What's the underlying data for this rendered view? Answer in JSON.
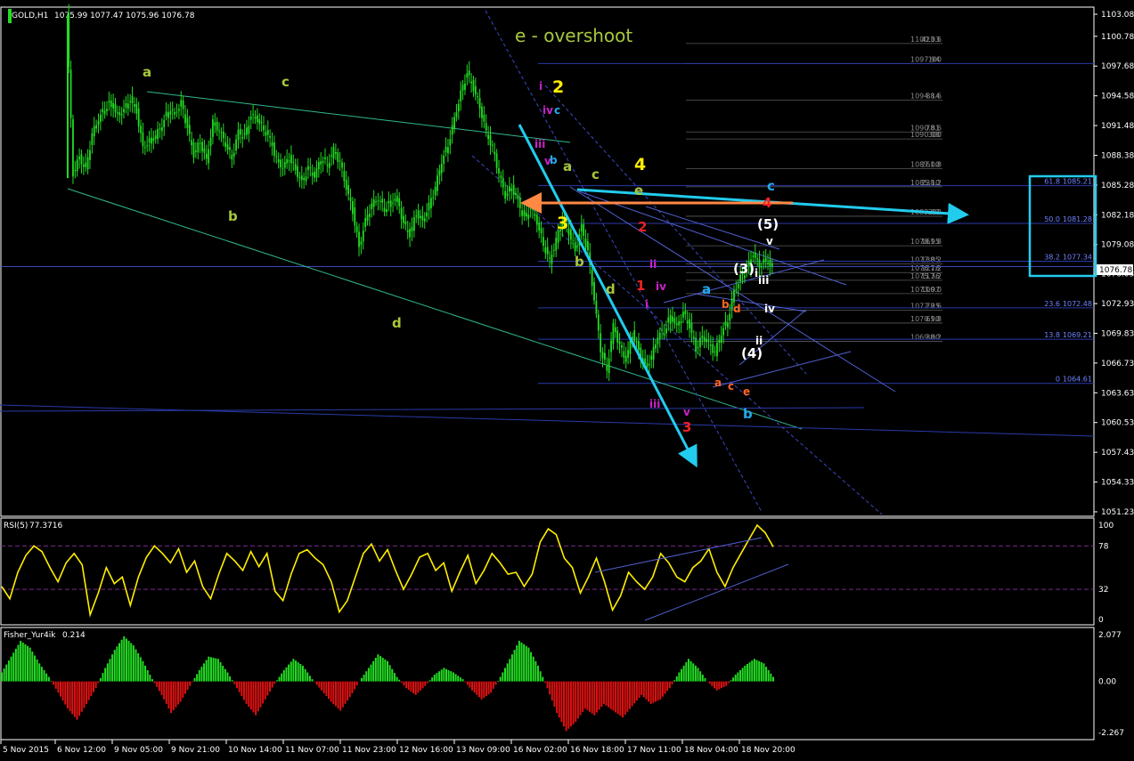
{
  "header": {
    "symbol_label": "GOLD,H1",
    "ohlc": "1075.99 1077.47 1075.96 1076.78",
    "title_annotation": "e - overshoot"
  },
  "colors": {
    "background": "#000000",
    "candle": "#22dd22",
    "price_line": "#2a3aa8",
    "rsi_line": "#ffee00",
    "fisher_up": "#22dd22",
    "fisher_down": "#dd1111",
    "cyan": "#22ccee",
    "orange": "#ff8844",
    "wave_green": "#a8c83c",
    "wave_yellow": "#ffee00",
    "wave_magenta": "#cc22cc",
    "wave_red": "#ee2222",
    "wave_blue": "#22aaee",
    "wave_orange": "#ff6622"
  },
  "chart_data": [
    {
      "type": "candlestick",
      "instrument": "GOLD",
      "timeframe": "H1",
      "ylim": [
        1051.23,
        1103.08
      ],
      "price_ticks": [
        "1103.08",
        "1100.78",
        "1097.68",
        "1094.58",
        "1091.48",
        "1088.38",
        "1085.28",
        "1082.18",
        "1079.08",
        "1076.03",
        "1072.93",
        "1069.83",
        "1066.73",
        "1063.63",
        "1060.53",
        "1057.43",
        "1054.33",
        "1051.23"
      ],
      "current_price": "1076.78",
      "x_ticks": [
        "5 Nov 2015",
        "6 Nov 12:00",
        "9 Nov 05:00",
        "9 Nov 21:00",
        "10 Nov 14:00",
        "11 Nov 07:00",
        "11 Nov 23:00",
        "12 Nov 16:00",
        "13 Nov 09:00",
        "16 Nov 02:00",
        "16 Nov 18:00",
        "17 Nov 11:00",
        "18 Nov 04:00",
        "18 Nov 20:00"
      ],
      "price_path": [
        1103.0,
        1086.5,
        1088.2,
        1086.8,
        1090.5,
        1092.2,
        1093.3,
        1094.0,
        1092.5,
        1093.1,
        1094.2,
        1093.0,
        1089.2,
        1089.8,
        1090.4,
        1091.6,
        1093.1,
        1092.7,
        1093.8,
        1091.2,
        1088.5,
        1089.8,
        1087.8,
        1091.8,
        1091.0,
        1089.6,
        1088.1,
        1090.8,
        1090.2,
        1092.5,
        1092.2,
        1091.1,
        1090.1,
        1087.9,
        1087.1,
        1088.2,
        1086.9,
        1085.5,
        1087.0,
        1086.2,
        1088.1,
        1087.4,
        1088.9,
        1087.6,
        1085.0,
        1082.6,
        1078.8,
        1081.5,
        1083.2,
        1083.9,
        1082.8,
        1083.6,
        1083.8,
        1081.2,
        1080.1,
        1082.4,
        1081.5,
        1083.1,
        1085.0,
        1087.8,
        1089.5,
        1092.2,
        1094.8,
        1096.9,
        1095.4,
        1093.5,
        1090.8,
        1089.1,
        1086.5,
        1084.2,
        1085.1,
        1083.6,
        1081.7,
        1082.9,
        1081.5,
        1079.1,
        1077.4,
        1079.5,
        1081.6,
        1080.4,
        1078.5,
        1080.9,
        1078.2,
        1073.4,
        1068.2,
        1066.0,
        1070.6,
        1068.5,
        1067.0,
        1069.8,
        1068.1,
        1066.3,
        1067.3,
        1069.6,
        1070.1,
        1071.7,
        1070.5,
        1071.9,
        1070.6,
        1068.2,
        1069.5,
        1068.8,
        1067.8,
        1069.9,
        1071.2,
        1074.2,
        1075.6,
        1076.5,
        1078.1,
        1076.9,
        1077.5,
        1076.8
      ],
      "fib_levels_upper": [
        {
          "pct": "423.6",
          "price": "1100.03"
        },
        {
          "pct": "100",
          "price": "1097.94"
        },
        {
          "pct": "88.6",
          "price": "1094.14"
        },
        {
          "pct": "78.6",
          "price": "1090.81"
        },
        {
          "pct": "300",
          "price": "1090.08"
        },
        {
          "pct": "261.8",
          "price": "1087.00"
        },
        {
          "pct": "238.2",
          "price": "1085.10"
        },
        {
          "pct": "200",
          "price": "1082.03"
        },
        {
          "pct": "161.8",
          "price": "1078.95"
        },
        {
          "pct": "138.2",
          "price": "1077.05"
        },
        {
          "pct": "127.2",
          "price": "1076.16"
        },
        {
          "pct": "117.2",
          "price": "1075.36"
        },
        {
          "pct": "100.0",
          "price": "1073.97"
        },
        {
          "pct": "78.6",
          "price": "1072.25"
        },
        {
          "pct": "61.8",
          "price": "1070.90"
        },
        {
          "pct": "38.2",
          "price": "1069.00"
        }
      ],
      "fib_levels_right": [
        {
          "pct": "61.8",
          "price": "1085.21"
        },
        {
          "pct": "50.0",
          "price": "1081.28"
        },
        {
          "pct": "38.2",
          "price": "1077.34"
        },
        {
          "pct": "23.6",
          "price": "1072.48"
        },
        {
          "pct": "13.8",
          "price": "1069.21"
        },
        {
          "pct": "0",
          "price": "1064.61"
        }
      ],
      "wave_labels": [
        "a",
        "b",
        "c",
        "d",
        "e",
        "1",
        "2",
        "3",
        "4",
        "5",
        "(3)",
        "(4)",
        "(5)",
        "i",
        "ii",
        "iii",
        "iv",
        "v"
      ]
    },
    {
      "type": "line",
      "indicator": "RSI(5)",
      "value_label": "77.3716",
      "ylim": [
        0,
        100
      ],
      "ticks": [
        "100",
        "78",
        "32",
        "0"
      ],
      "levels": [
        78,
        32
      ],
      "values": [
        35,
        22,
        50,
        68,
        78,
        72,
        55,
        40,
        60,
        70,
        58,
        5,
        28,
        55,
        38,
        45,
        15,
        45,
        66,
        78,
        70,
        60,
        75,
        50,
        62,
        35,
        22,
        48,
        70,
        62,
        52,
        72,
        56,
        70,
        30,
        20,
        48,
        70,
        74,
        65,
        58,
        40,
        8,
        20,
        45,
        70,
        80,
        62,
        74,
        52,
        32,
        48,
        66,
        70,
        52,
        60,
        30,
        50,
        68,
        38,
        52,
        70,
        60,
        48,
        50,
        35,
        48,
        82,
        96,
        90,
        65,
        55,
        28,
        45,
        65,
        40,
        10,
        25,
        50,
        40,
        32,
        45,
        70,
        60,
        45,
        40,
        55,
        62,
        75,
        50,
        35,
        55,
        70,
        85,
        100,
        92,
        77
      ]
    },
    {
      "type": "bar",
      "indicator": "Fisher_Yur4ik",
      "value_label": "0.214",
      "ylim": [
        -2.267,
        2.077
      ],
      "ticks": [
        "2.077",
        "0.00",
        "-2.267"
      ],
      "values": [
        0.4,
        1.1,
        1.8,
        1.5,
        0.8,
        0.2,
        -0.5,
        -1.2,
        -1.7,
        -1.0,
        -0.3,
        0.6,
        1.4,
        2.0,
        1.6,
        0.9,
        0.1,
        -0.6,
        -1.4,
        -0.9,
        -0.2,
        0.5,
        1.1,
        1.0,
        0.4,
        -0.3,
        -1.0,
        -1.5,
        -0.8,
        -0.1,
        0.5,
        1.0,
        0.7,
        0.1,
        -0.4,
        -0.9,
        -1.3,
        -0.7,
        0.0,
        0.6,
        1.2,
        0.9,
        0.2,
        -0.3,
        -0.6,
        -0.2,
        0.3,
        0.6,
        0.4,
        0.1,
        -0.4,
        -0.8,
        -0.5,
        0.2,
        1.0,
        1.8,
        1.5,
        0.7,
        -0.3,
        -1.4,
        -2.2,
        -1.8,
        -1.2,
        -1.5,
        -1.0,
        -1.3,
        -1.6,
        -1.1,
        -0.6,
        -1.0,
        -0.8,
        -0.3,
        0.4,
        1.0,
        0.6,
        0.0,
        -0.4,
        -0.2,
        0.3,
        0.7,
        1.0,
        0.8,
        0.2
      ]
    }
  ],
  "annotations": [
    {
      "text": "a",
      "color": "#a8c83c"
    },
    {
      "text": "b",
      "color": "#a8c83c"
    },
    {
      "text": "c",
      "color": "#a8c83c"
    },
    {
      "text": "d",
      "color": "#a8c83c"
    },
    {
      "text": "2",
      "color": "#ffee00"
    },
    {
      "text": "4",
      "color": "#ffee00"
    },
    {
      "text": "3",
      "color": "#ffee00"
    },
    {
      "text": "i",
      "color": "#cc22cc"
    },
    {
      "text": "iii",
      "color": "#cc22cc"
    },
    {
      "text": "iv",
      "color": "#cc22cc"
    },
    {
      "text": "v",
      "color": "#cc22cc"
    },
    {
      "text": "ii",
      "color": "#cc22cc"
    },
    {
      "text": "i",
      "color": "#cc22cc"
    },
    {
      "text": "iv",
      "color": "#cc22cc"
    },
    {
      "text": "iii",
      "color": "#cc22cc"
    },
    {
      "text": "v",
      "color": "#cc22cc"
    },
    {
      "text": "c",
      "color": "#22aaee"
    },
    {
      "text": "b",
      "color": "#22aaee"
    },
    {
      "text": "a",
      "color": "#a8c83c"
    },
    {
      "text": "c",
      "color": "#a8c83c"
    },
    {
      "text": "e",
      "color": "#a8c83c"
    },
    {
      "text": "b",
      "color": "#a8c83c"
    },
    {
      "text": "d",
      "color": "#a8c83c"
    },
    {
      "text": "1",
      "color": "#ee2222"
    },
    {
      "text": "2",
      "color": "#ee2222"
    },
    {
      "text": "3",
      "color": "#ee2222"
    },
    {
      "text": "4",
      "color": "#ee2222"
    },
    {
      "text": "c",
      "color": "#22aaee"
    },
    {
      "text": "a",
      "color": "#22aaee"
    },
    {
      "text": "b",
      "color": "#22aaee"
    },
    {
      "text": "b",
      "color": "#ff6622"
    },
    {
      "text": "d",
      "color": "#ff6622"
    },
    {
      "text": "a",
      "color": "#ff6622"
    },
    {
      "text": "c",
      "color": "#ff6622"
    },
    {
      "text": "e",
      "color": "#ff6622"
    },
    {
      "text": "(5)",
      "color": "#ffffff"
    },
    {
      "text": "(3)",
      "color": "#ffffff"
    },
    {
      "text": "(4)",
      "color": "#ffffff"
    },
    {
      "text": "v",
      "color": "#ffffff"
    },
    {
      "text": "iii",
      "color": "#ffffff"
    },
    {
      "text": "iv",
      "color": "#ffffff"
    },
    {
      "text": "ii",
      "color": "#ffffff"
    },
    {
      "text": "i",
      "color": "#ffffff"
    }
  ]
}
